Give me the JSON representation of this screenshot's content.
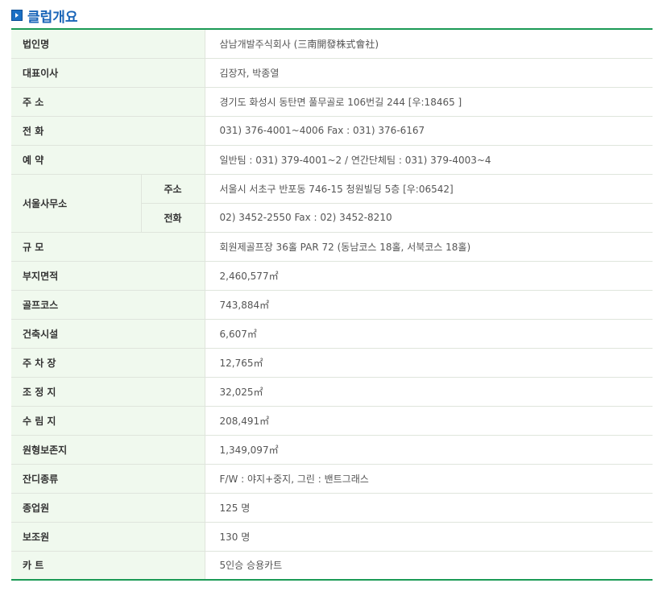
{
  "section": {
    "title": "클럽개요",
    "icon": "arrow-right-icon"
  },
  "rows": [
    {
      "label": "법인명",
      "value": "삼남개발주식회사 (三南開發株式會社)"
    },
    {
      "label": "대표이사",
      "value": "김장자, 박종열"
    },
    {
      "label": "주 소",
      "value": "경기도 화성시 동탄면 풀무골로 106번길 244 [우:18465 ]"
    },
    {
      "label": "전 화",
      "value": "031) 376-4001~4006 Fax : 031) 376-6167"
    },
    {
      "label": "예 약",
      "value": "일반팀 : 031) 379-4001~2 / 연간단체팀 : 031) 379-4003~4"
    }
  ],
  "seoul_office": {
    "label": "서울사무소",
    "address_label": "주소",
    "address_value": "서울시 서초구 반포동 746-15 청원빌딩 5층 [우:06542]",
    "phone_label": "전화",
    "phone_value": "02) 3452-2550 Fax : 02) 3452-8210"
  },
  "rows2": [
    {
      "label": "규 모",
      "value": "회원제골프장 36홀 PAR 72 (동남코스 18홀, 서북코스 18홀)"
    },
    {
      "label": "부지면적",
      "value": "2,460,577㎡"
    },
    {
      "label": "골프코스",
      "value": "743,884㎡"
    },
    {
      "label": "건축시설",
      "value": "6,607㎡"
    },
    {
      "label": "주 차 장",
      "value": "12,765㎡"
    },
    {
      "label": "조 정 지",
      "value": "32,025㎡"
    },
    {
      "label": "수 림 지",
      "value": "208,491㎡"
    },
    {
      "label": "원형보존지",
      "value": "1,349,097㎡"
    },
    {
      "label": "잔디종류",
      "value": "F/W : 야지+중지, 그린 : 밴트그래스"
    },
    {
      "label": "종업원",
      "value": "125 명"
    },
    {
      "label": "보조원",
      "value": "130 명"
    },
    {
      "label": "카 트",
      "value": "5인승 승용카트"
    }
  ]
}
